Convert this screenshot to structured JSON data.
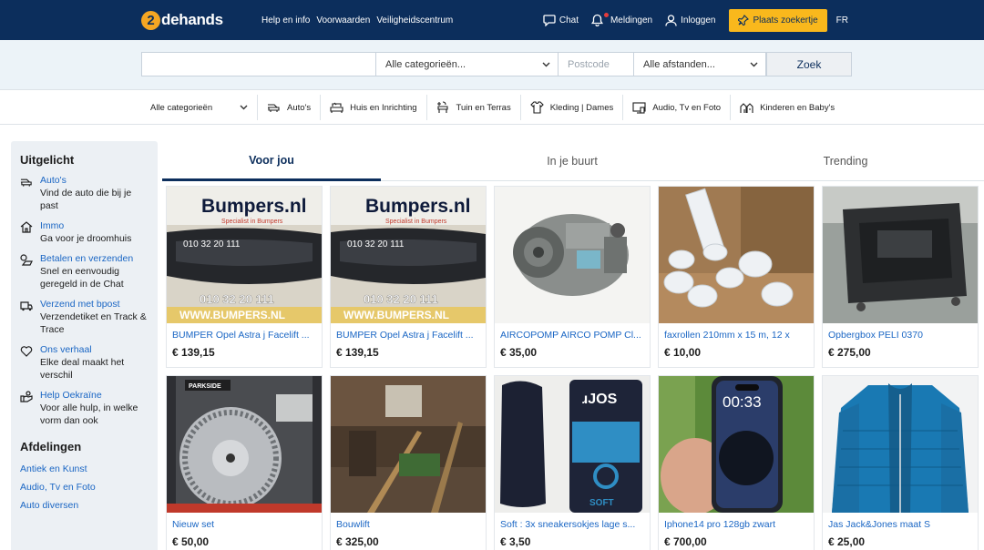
{
  "header": {
    "logo_mark": "2",
    "logo_text": "dehands",
    "links": [
      "Help en info",
      "Voorwaarden",
      "Veiligheidscentrum"
    ],
    "chat": "Chat",
    "notifications": "Meldingen",
    "login": "Inloggen",
    "place_ad": "Plaats zoekertje",
    "language": "FR"
  },
  "search": {
    "query_value": "",
    "category": "Alle categorieën...",
    "postcode_placeholder": "Postcode",
    "distance": "Alle afstanden...",
    "button": "Zoek"
  },
  "categories": {
    "all": "Alle categorieën",
    "items": [
      {
        "label": "Auto's",
        "icon": "car-icon"
      },
      {
        "label": "Huis en Inrichting",
        "icon": "sofa-icon"
      },
      {
        "label": "Tuin en Terras",
        "icon": "garden-icon"
      },
      {
        "label": "Kleding | Dames",
        "icon": "clothing-icon"
      },
      {
        "label": "Audio, Tv en Foto",
        "icon": "tv-icon"
      },
      {
        "label": "Kinderen en Baby's",
        "icon": "kids-icon"
      }
    ]
  },
  "sidebar": {
    "heading": "Uitgelicht",
    "entries": [
      {
        "icon": "car-icon",
        "link": "Auto's",
        "desc": "Vind de auto die bij je past"
      },
      {
        "icon": "house-icon",
        "link": "Immo",
        "desc": "Ga voor je droomhuis"
      },
      {
        "icon": "shipping-icon",
        "link": "Betalen en verzenden",
        "desc": "Snel en eenvoudig geregeld in de Chat"
      },
      {
        "icon": "truck-icon",
        "link": "Verzend met bpost",
        "desc": "Verzendetiket en Track & Trace"
      },
      {
        "icon": "heart-icon",
        "link": "Ons verhaal",
        "desc": "Elke deal maakt het verschil"
      },
      {
        "icon": "help-icon",
        "link": "Help Oekraïne",
        "desc": "Voor alle hulp, in welke vorm dan ook"
      }
    ],
    "departments_heading": "Afdelingen",
    "departments": [
      "Antiek en Kunst",
      "Audio, Tv en Foto",
      "Auto diversen"
    ]
  },
  "tabs": [
    "Voor jou",
    "In je buurt",
    "Trending"
  ],
  "listings": [
    {
      "title": "BUMPER Opel Astra j Facelift ...",
      "price": "€ 139,15",
      "banner": "Bumpers.nl",
      "banner_sub": "Specialist in Bumpers",
      "phone": "010 32 20 111",
      "url_text": "WWW.BUMPERS.NL"
    },
    {
      "title": "BUMPER Opel Astra j Facelift ...",
      "price": "€ 139,15",
      "banner": "Bumpers.nl",
      "banner_sub": "Specialist in Bumpers",
      "phone": "010 32 20 111",
      "url_text": "WWW.BUMPERS.NL"
    },
    {
      "title": "AIRCOPOMP AIRCO POMP Cl...",
      "price": "€ 35,00"
    },
    {
      "title": "faxrollen 210mm x 15 m, 12 x",
      "price": "€ 10,00"
    },
    {
      "title": "Opbergbox PELI 0370",
      "price": "€ 275,00"
    },
    {
      "title": "Nieuw set",
      "price": "€ 50,00",
      "brand": "PARKSIDE"
    },
    {
      "title": "Bouwlift",
      "price": "€ 325,00"
    },
    {
      "title": "Soft : 3x sneakersokjes lage s...",
      "price": "€ 3,50",
      "sock_brand": "SOFT"
    },
    {
      "title": "Iphone14 pro 128gb zwart",
      "price": "€ 700,00",
      "phone_time": "00:33"
    },
    {
      "title": "Jas Jack&Jones maat S",
      "price": "€ 25,00"
    }
  ],
  "colors": {
    "header_bg": "#0c2e5c",
    "accent_yellow": "#f9b81c",
    "link_blue": "#1a66c4"
  }
}
